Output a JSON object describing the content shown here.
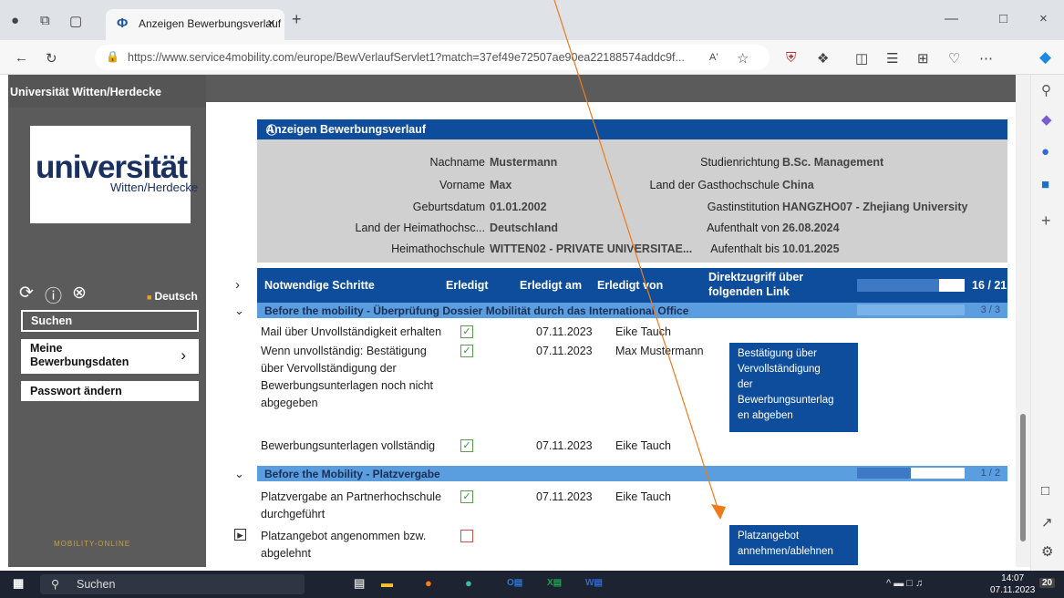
{
  "browser": {
    "tab_title": "Anzeigen Bewerbungsverlauf",
    "url": "https://www.service4mobility.com/europe/BewVerlaufServlet1?match=37ef49e72507ae90ea22188574addc9f..."
  },
  "sidebar": {
    "university": "Universität Witten/Herdecke",
    "logo_main": "universität",
    "logo_sub": "Witten/Herdecke",
    "language": "Deutsch",
    "menu": {
      "search": "Suchen",
      "my_data": "Meine Bewerbungsdaten",
      "password": "Passwort ändern"
    },
    "brand": "MOBILITY-ONLINE"
  },
  "main": {
    "title": "Anzeigen Bewerbungsverlauf",
    "info": {
      "nachname_label": "Nachname",
      "nachname": "Mustermann",
      "vorname_label": "Vorname",
      "vorname": "Max",
      "geburtsdatum_label": "Geburtsdatum",
      "geburtsdatum": "01.01.2002",
      "heimatland_label": "Land der Heimathochsc...",
      "heimatland": "Deutschland",
      "heimathochschule_label": "Heimathochschule",
      "heimathochschule": "WITTEN02 - PRIVATE UNIVERSITAE...",
      "studienrichtung_label": "Studienrichtung",
      "studienrichtung": "B.Sc. Management",
      "gastland_label": "Land der Gasthochschule",
      "gastland": "China",
      "gastinstitution_label": "Gastinstitution",
      "gastinstitution": "HANGZHO07 - Zhejiang University",
      "aufenthalt_von_label": "Aufenthalt von",
      "aufenthalt_von": "26.08.2024",
      "aufenthalt_bis_label": "Aufenthalt bis",
      "aufenthalt_bis": "10.01.2025"
    },
    "table_head": {
      "steps": "Notwendige Schritte",
      "done": "Erledigt",
      "done_at": "Erledigt am",
      "done_by": "Erledigt von",
      "direct_link_1": "Direktzugriff über",
      "direct_link_2": "folgenden Link",
      "progress": "16 / 21",
      "progress_fraction": 0.76
    },
    "section1": {
      "title": "Before the mobility - Überprüfung Dossier Mobilität durch das International Office",
      "count": "3 / 3",
      "progress_fraction": 1.0,
      "rows": [
        {
          "step": "Mail über Unvollständigkeit erhalten",
          "date": "07.11.2023",
          "by": "Eike Tauch"
        },
        {
          "step_1": "Wenn unvollständig: Bestätigung",
          "step_2": "über Vervollständigung der",
          "step_3": "Bewerbungsunterlagen noch nicht",
          "step_4": "abgegeben",
          "date": "07.11.2023",
          "by": "Max Mustermann",
          "link_1": "Bestätigung über",
          "link_2": "Vervollständigung",
          "link_3": "der",
          "link_4": "Bewerbungsunterlag",
          "link_5": "en abgeben"
        },
        {
          "step": "Bewerbungsunterlagen vollständig",
          "date": "07.11.2023",
          "by": "Eike Tauch"
        }
      ]
    },
    "section2": {
      "title": "Before the Mobility - Platzvergabe",
      "count": "1 / 2",
      "progress_fraction": 0.5,
      "rows": [
        {
          "step_1": "Platzvergabe an Partnerhochschule",
          "step_2": "durchgeführt",
          "date": "07.11.2023",
          "by": "Eike Tauch"
        },
        {
          "step_1": "Platzangebot angenommen bzw.",
          "step_2": "abgelehnt",
          "link_1": "Platzangebot",
          "link_2": "annehmen/ablehnen"
        }
      ]
    }
  },
  "taskbar": {
    "search": "Suchen",
    "time": "14:07",
    "date": "07.11.2023",
    "badge": "20"
  },
  "colors": {
    "header_blue": "#0d4d9c",
    "section_blue": "#5b9ee0",
    "annotation_arrow": "#f07a1a"
  }
}
